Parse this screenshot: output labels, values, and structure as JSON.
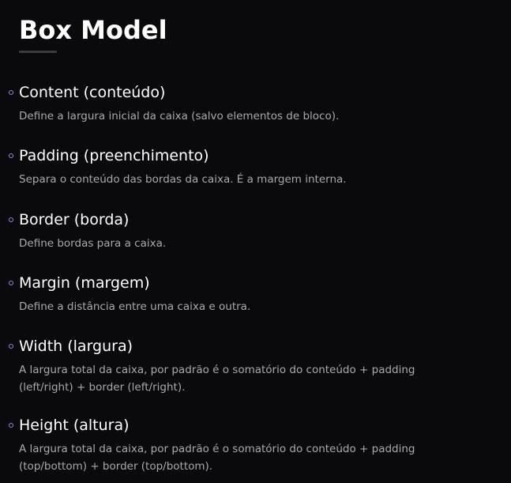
{
  "page": {
    "title": "Box Model"
  },
  "colors": {
    "background": "#0a090c",
    "heading": "#ffffff",
    "body_text": "#a9a8b0",
    "bullet": "#8f86e8",
    "underline": "#3b3a40"
  },
  "items": [
    {
      "title": "Content (conteúdo)",
      "description": "Define a largura inicial da caixa (salvo elementos de bloco)."
    },
    {
      "title": "Padding (preenchimento)",
      "description": "Separa o conteúdo das bordas da caixa. É a margem interna."
    },
    {
      "title": "Border (borda)",
      "description": "Define bordas para a caixa."
    },
    {
      "title": "Margin (margem)",
      "description": "Define a distância entre uma caixa e outra."
    },
    {
      "title": "Width (largura)",
      "description": "A largura total da caixa, por padrão é o somatório do conteúdo + padding (left/right) + border (left/right)."
    },
    {
      "title": "Height (altura)",
      "description": "A largura total da caixa, por padrão é o somatório do conteúdo + padding (top/bottom) + border (top/bottom)."
    }
  ]
}
